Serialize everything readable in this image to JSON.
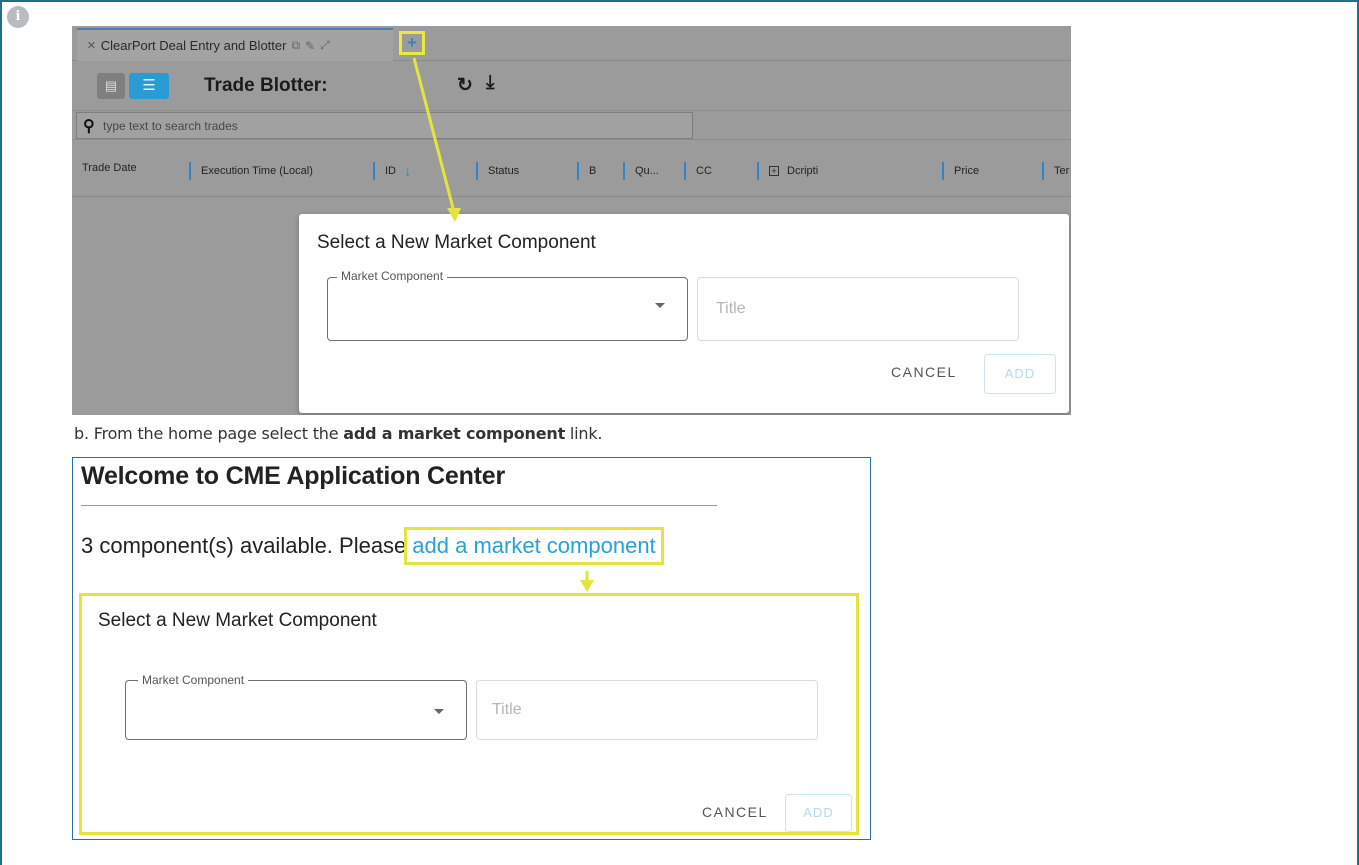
{
  "info_icon": "info-icon",
  "shot1": {
    "tab": {
      "label": "ClearPort Deal Entry and Blotter",
      "add_icon": "+"
    },
    "toolbar": {
      "title": "Trade Blotter:"
    },
    "search": {
      "placeholder": "type text to search trades"
    },
    "columns": [
      {
        "label": "Trade Date"
      },
      {
        "label": "Execution Time (Local)"
      },
      {
        "label": "ID"
      },
      {
        "label": "Status"
      },
      {
        "label": "B"
      },
      {
        "label": "Qu..."
      },
      {
        "label": "CC"
      },
      {
        "label": "Dcripti"
      },
      {
        "label": "Price"
      },
      {
        "label": "Ter"
      }
    ],
    "dialog": {
      "title": "Select a New Market Component",
      "market_component_label": "Market Component",
      "title_placeholder": "Title",
      "cancel_label": "CANCEL",
      "add_label": "ADD"
    }
  },
  "caption": {
    "prefix": "b. From the home page select the ",
    "bold": "add a market component",
    "suffix": " link."
  },
  "shot2": {
    "welcome": "Welcome to CME Application Center",
    "available_text": "3 component(s) available. Please",
    "link_text": "add a market component",
    "dialog": {
      "title": "Select a New Market Component",
      "market_component_label": "Market Component",
      "title_placeholder": "Title",
      "cancel_label": "CANCEL",
      "add_label": "ADD"
    }
  },
  "colors": {
    "frame": "#1f6f86",
    "accent_blue": "#2e86c8",
    "highlight_yellow": "#e3e43e",
    "link_blue": "#2aa0d6"
  }
}
